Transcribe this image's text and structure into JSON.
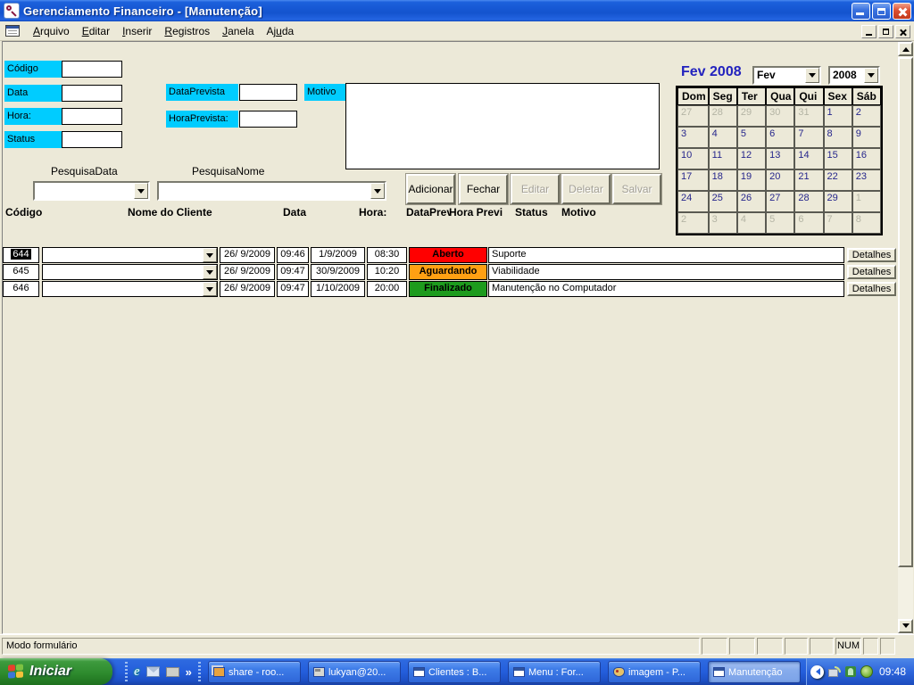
{
  "window": {
    "title": "Gerenciamento Financeiro - [Manutenção]"
  },
  "menu": {
    "items": [
      {
        "label": "Arquivo",
        "u": 0
      },
      {
        "label": "Editar",
        "u": 0
      },
      {
        "label": "Inserir",
        "u": 0
      },
      {
        "label": "Registros",
        "u": 0
      },
      {
        "label": "Janela",
        "u": 0
      },
      {
        "label": "Ajuda",
        "u": 2
      }
    ]
  },
  "form": {
    "label_color": "#00CCFF",
    "labels": {
      "codigo": "Código",
      "data": "Data",
      "hora": "Hora:",
      "status": "Status",
      "data_prevista": "DataPrevista",
      "hora_prevista": "HoraPrevista:",
      "motivo": "Motivo",
      "pesquisa_data": "PesquisaData",
      "pesquisa_nome": "PesquisaNome"
    },
    "buttons": [
      {
        "label": "Adicionar",
        "enabled": true
      },
      {
        "label": "Fechar",
        "enabled": true
      },
      {
        "label": "Editar",
        "enabled": false
      },
      {
        "label": "Deletar",
        "enabled": false
      },
      {
        "label": "Salvar",
        "enabled": false
      }
    ]
  },
  "grid": {
    "columns": [
      "Código",
      "Nome do Cliente",
      "Data",
      "Hora:",
      "DataPrevi",
      "Hora Previ",
      "Status",
      "Motivo"
    ],
    "rows": [
      {
        "codigo": "644",
        "selected": true,
        "data": "26/ 9/2009",
        "hora": "09:46",
        "data_prev": "1/9/2009",
        "hora_prev": "08:30",
        "status": "Aberto",
        "status_color": "#FF0000",
        "motivo": "Suporte",
        "detalhes": "Detalhes"
      },
      {
        "codigo": "645",
        "selected": false,
        "data": "26/ 9/2009",
        "hora": "09:47",
        "data_prev": "30/9/2009",
        "hora_prev": "10:20",
        "status": "Aguardando",
        "status_color": "#FFA013",
        "motivo": "Viabilidade",
        "detalhes": "Detalhes"
      },
      {
        "codigo": "646",
        "selected": false,
        "data": "26/ 9/2009",
        "hora": "09:47",
        "data_prev": "1/10/2009",
        "hora_prev": "20:00",
        "status": "Finalizado",
        "status_color": "#1D9B1D",
        "motivo": "Manutenção no Computador",
        "detalhes": "Detalhes"
      }
    ]
  },
  "calendar": {
    "title": "Fev 2008",
    "month_value": "Fev",
    "year_value": "2008",
    "day_headers": [
      "Dom",
      "Seg",
      "Ter",
      "Qua",
      "Qui",
      "Sex",
      "Sáb"
    ],
    "weeks": [
      [
        {
          "d": "27",
          "muted": true
        },
        {
          "d": "28",
          "muted": true
        },
        {
          "d": "29",
          "muted": true
        },
        {
          "d": "30",
          "muted": true
        },
        {
          "d": "31",
          "muted": true
        },
        {
          "d": "1"
        },
        {
          "d": "2"
        }
      ],
      [
        {
          "d": "3"
        },
        {
          "d": "4"
        },
        {
          "d": "5"
        },
        {
          "d": "6"
        },
        {
          "d": "7"
        },
        {
          "d": "8"
        },
        {
          "d": "9"
        }
      ],
      [
        {
          "d": "10"
        },
        {
          "d": "11"
        },
        {
          "d": "12"
        },
        {
          "d": "13"
        },
        {
          "d": "14"
        },
        {
          "d": "15"
        },
        {
          "d": "16"
        }
      ],
      [
        {
          "d": "17"
        },
        {
          "d": "18"
        },
        {
          "d": "19"
        },
        {
          "d": "20"
        },
        {
          "d": "21"
        },
        {
          "d": "22"
        },
        {
          "d": "23"
        }
      ],
      [
        {
          "d": "24"
        },
        {
          "d": "25"
        },
        {
          "d": "26"
        },
        {
          "d": "27"
        },
        {
          "d": "28"
        },
        {
          "d": "29"
        },
        {
          "d": "1",
          "muted": true
        }
      ],
      [
        {
          "d": "2",
          "muted": true
        },
        {
          "d": "3",
          "muted": true
        },
        {
          "d": "4",
          "muted": true
        },
        {
          "d": "5",
          "muted": true
        },
        {
          "d": "6",
          "muted": true
        },
        {
          "d": "7",
          "muted": true
        },
        {
          "d": "8",
          "muted": true
        }
      ]
    ]
  },
  "statusbar": {
    "mode": "Modo formulário",
    "panels": [
      "",
      "",
      "",
      "",
      "",
      "NUM",
      "",
      ""
    ]
  },
  "taskbar": {
    "start": "Iniciar",
    "overflow": "»",
    "quicklaunch": [
      {
        "icon": "ie-icon",
        "glyph": "e"
      },
      {
        "icon": "mail-icon"
      },
      {
        "icon": "desktop-icon"
      }
    ],
    "tasks": [
      {
        "label": "share - roo...",
        "icon": "share-icon",
        "active": false
      },
      {
        "label": "lukyan@20...",
        "icon": "terminal-icon",
        "active": false
      },
      {
        "label": "Clientes : B...",
        "icon": "form-icon",
        "active": false
      },
      {
        "label": "Menu : For...",
        "icon": "form-icon",
        "active": false
      },
      {
        "label": "imagem - P...",
        "icon": "paint-icon",
        "active": false
      },
      {
        "label": "Manutenção",
        "icon": "form-icon",
        "active": true
      }
    ],
    "clock": "09:48"
  }
}
